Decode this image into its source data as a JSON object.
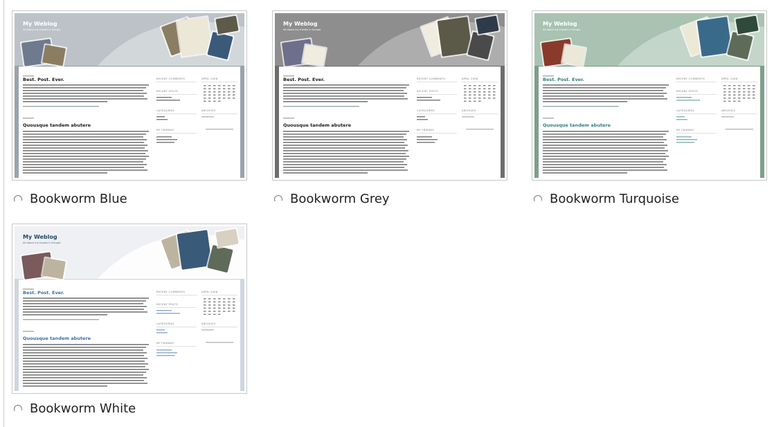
{
  "themes": [
    {
      "id": "blue",
      "label": "Bookworm Blue",
      "colors": {
        "band": "#bcc2c8",
        "arc": "#d6dadd",
        "accent": "#1a1a1a",
        "frame": "#9aa3ab",
        "rail": "#9aa3ab"
      },
      "books": [
        "#6f7a8e",
        "#8a7d62",
        "#ece8d8",
        "#3b5a7a",
        "#5e5a4a"
      ],
      "preview": {
        "blog_title": "My Weblog",
        "blog_sub": "All about my travels in Europe",
        "post1": "Best. Post. Ever.",
        "post2": "Quousque tandem abutere",
        "side1": "RECENT COMMENTS",
        "side2": "APRIL 2008",
        "side3": "RECENT POSTS",
        "side4": "CATEGORIES",
        "side5": "ARCHIVES",
        "side6": "MY FRIENDS"
      }
    },
    {
      "id": "grey",
      "label": "Bookworm Grey",
      "colors": {
        "band": "#8e8e8e",
        "arc": "#b3b3b3",
        "accent": "#1a1a1a",
        "frame": "#6e6e6e",
        "rail": "#6e6e6e"
      },
      "books": [
        "#6d6f8c",
        "#f0ede0",
        "#5b5a48",
        "#4a4a4a",
        "#2f3a4a"
      ],
      "preview": {
        "blog_title": "My Weblog",
        "blog_sub": "All about my travels in Europe",
        "post1": "Best. Post. Ever.",
        "post2": "Quousque tandem abutere",
        "side1": "RECENT COMMENTS",
        "side2": "APRIL 2008",
        "side3": "RECENT POSTS",
        "side4": "CATEGORIES",
        "side5": "ARCHIVES",
        "side6": "MY FRIENDS"
      }
    },
    {
      "id": "turquoise",
      "label": "Bookworm Turquoise",
      "colors": {
        "band": "#a9c2b2",
        "arc": "#c8d9cd",
        "accent": "#2f7f7a",
        "frame": "#7e9e8b",
        "rail": "#7e9e8b"
      },
      "books": [
        "#8a3a2a",
        "#ece8d8",
        "#3a6a8a",
        "#5e6b58",
        "#2f4a3a"
      ],
      "preview": {
        "blog_title": "My Weblog",
        "blog_sub": "All about my travels in Europe",
        "post1": "Best. Post. Ever.",
        "post2": "Quousque tandem abutere",
        "side1": "RECENT COMMENTS",
        "side2": "APRIL 2008",
        "side3": "RECENT POSTS",
        "side4": "CATEGORIES",
        "side5": "ARCHIVES",
        "side6": "MY FRIENDS"
      }
    },
    {
      "id": "white",
      "label": "Bookworm White",
      "colors": {
        "band": "#eef0f3",
        "arc": "#ffffff",
        "accent": "#3a6fa8",
        "frame": "#cfd6de",
        "rail": "#cfd6de"
      },
      "books": [
        "#7a5a5a",
        "#bdb4a0",
        "#3a5a7a",
        "#5e6b58",
        "#d8d0c0"
      ],
      "preview": {
        "blog_title": "My Weblog",
        "blog_sub": "All about my travels in Europe",
        "post1": "Best. Post. Ever.",
        "post2": "Quousque tandem abutere",
        "side1": "RECENT COMMENTS",
        "side2": "APRIL 2008",
        "side3": "RECENT POSTS",
        "side4": "CATEGORIES",
        "side5": "ARCHIVES",
        "side6": "MY FRIENDS"
      }
    }
  ]
}
